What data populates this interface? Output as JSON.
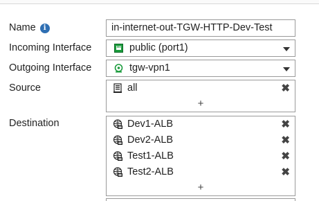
{
  "form": {
    "name": {
      "label": "Name",
      "value": "in-internet-out-TGW-HTTP-Dev-Test"
    },
    "incoming": {
      "label": "Incoming Interface",
      "value": "public (port1)",
      "icon": "port-icon"
    },
    "outgoing": {
      "label": "Outgoing Interface",
      "value": "tgw-vpn1",
      "icon": "vpn-tunnel-icon"
    },
    "source": {
      "label": "Source",
      "items": [
        {
          "label": "all",
          "icon": "address-object-icon"
        }
      ],
      "add_label": "+"
    },
    "destination": {
      "label": "Destination",
      "items": [
        {
          "label": "Dev1-ALB",
          "icon": "fqdn-address-icon"
        },
        {
          "label": "Dev2-ALB",
          "icon": "fqdn-address-icon"
        },
        {
          "label": "Test1-ALB",
          "icon": "fqdn-address-icon"
        },
        {
          "label": "Test2-ALB",
          "icon": "fqdn-address-icon"
        }
      ],
      "add_label": "+"
    },
    "remove_glyph": "✖"
  },
  "colors": {
    "info": "#2f6fb3",
    "port_green": "#1a9b3c",
    "border": "#9a9a9a"
  }
}
